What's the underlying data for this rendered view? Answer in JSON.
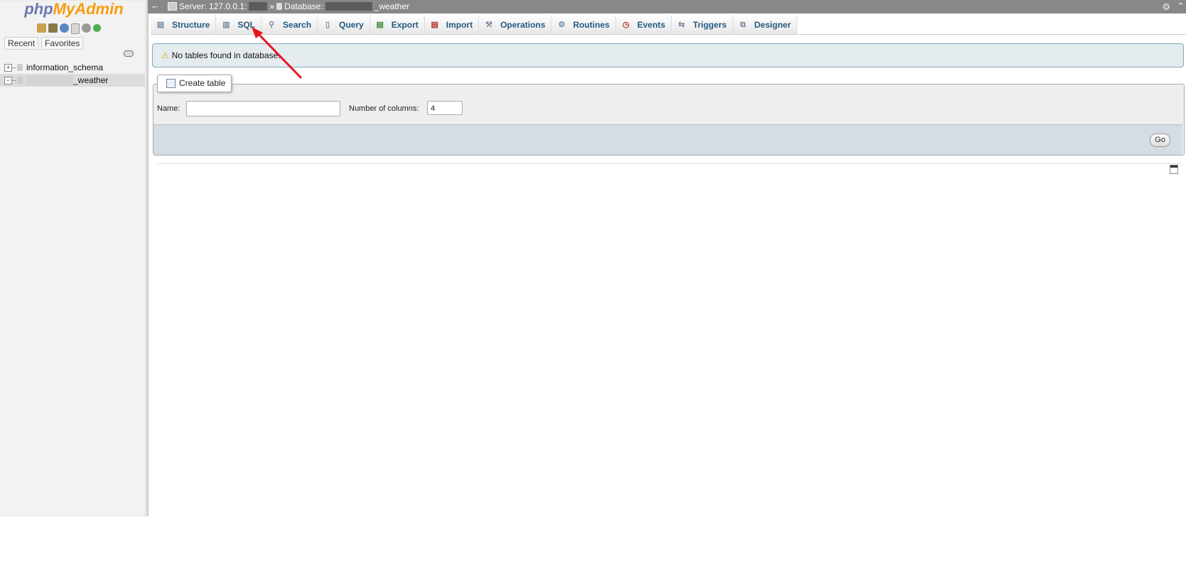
{
  "sidebar": {
    "logo_php": "php",
    "logo_myadmin": "MyAdmin",
    "icons": [
      "home-icon",
      "database-icon",
      "help-icon",
      "docs-icon",
      "settings-icon",
      "reload-icon"
    ],
    "tabs": [
      "Recent",
      "Favorites"
    ],
    "databases": [
      {
        "name": "information_schema",
        "selected": false
      },
      {
        "name_suffix": "_weather",
        "selected": true
      }
    ]
  },
  "topbar": {
    "back": "←",
    "server_label": "Server: 127.0.0.1:",
    "separator": "»",
    "database_label": "Database:",
    "database_suffix": "_weather"
  },
  "tabs": [
    {
      "label": "Structure",
      "icon": "structure-icon"
    },
    {
      "label": "SQL",
      "icon": "sql-icon"
    },
    {
      "label": "Search",
      "icon": "search-icon"
    },
    {
      "label": "Query",
      "icon": "query-icon"
    },
    {
      "label": "Export",
      "icon": "export-icon"
    },
    {
      "label": "Import",
      "icon": "import-icon"
    },
    {
      "label": "Operations",
      "icon": "wrench-icon"
    },
    {
      "label": "Routines",
      "icon": "routines-icon"
    },
    {
      "label": "Events",
      "icon": "clock-icon"
    },
    {
      "label": "Triggers",
      "icon": "triggers-icon"
    },
    {
      "label": "Designer",
      "icon": "designer-icon"
    }
  ],
  "notice": {
    "message": "No tables found in database."
  },
  "create_table": {
    "legend": "Create table",
    "name_label": "Name:",
    "name_value": "",
    "columns_label": "Number of columns:",
    "columns_value": "4",
    "go_label": "Go"
  },
  "colors": {
    "topbar": "#888888",
    "tab_text": "#235a81",
    "notice_bg": "#e5ecf0",
    "annotation_arrow": "#e8141e"
  }
}
